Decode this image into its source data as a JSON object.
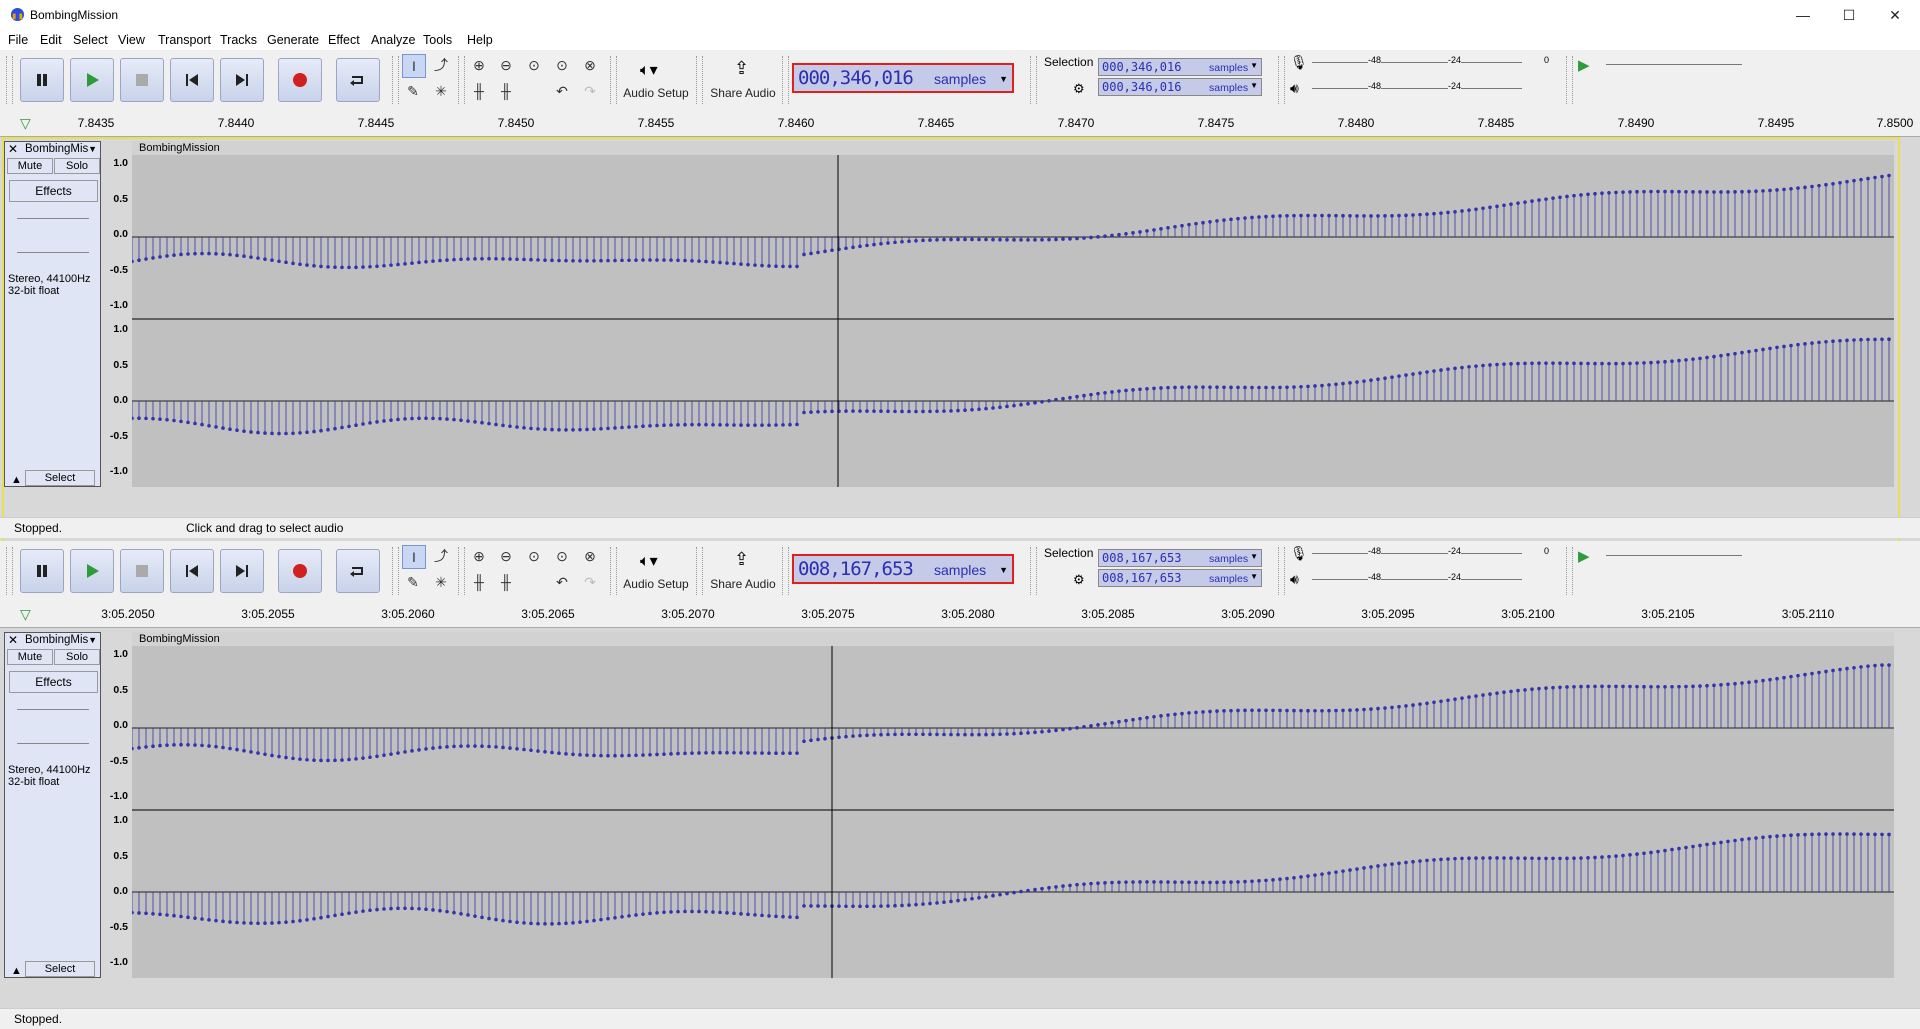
{
  "window": {
    "title": "BombingMission",
    "minimize": "—",
    "maximize": "☐",
    "close": "✕"
  },
  "menu": [
    "File",
    "Edit",
    "Select",
    "View",
    "Transport",
    "Tracks",
    "Generate",
    "Effect",
    "Analyze",
    "Tools",
    "Help"
  ],
  "toolbar": {
    "audio_setup": "Audio Setup",
    "share_audio": "Share Audio",
    "selection_label": "Selection"
  },
  "meters": {
    "rec_m48": "-48",
    "rec_m24": "-24",
    "rec_0": "0",
    "play_m48": "-48",
    "play_m24": "-24"
  },
  "panels": [
    {
      "time_value": "000,346,016",
      "time_unit": "samples",
      "selection_start": "000,346,016",
      "selection_end": "000,346,016",
      "selection_unit": "samples",
      "ruler_ticks": [
        "7.8435",
        "7.8440",
        "7.8445",
        "7.8450",
        "7.8455",
        "7.8460",
        "7.8465",
        "7.8470",
        "7.8475",
        "7.8480",
        "7.8485",
        "7.8490",
        "7.8495",
        "7.8500"
      ],
      "track": {
        "name": "BombingMis",
        "clip_name": "BombingMission",
        "mute": "Mute",
        "solo": "Solo",
        "effects": "Effects",
        "select": "Select",
        "info1": "Stereo, 44100Hz",
        "info2": "32-bit float"
      },
      "status_left": "Stopped.",
      "status_hint": "Click and drag to select audio"
    },
    {
      "time_value": "008,167,653",
      "time_unit": "samples",
      "selection_start": "008,167,653",
      "selection_end": "008,167,653",
      "selection_unit": "samples",
      "ruler_ticks": [
        "3:05.2050",
        "3:05.2055",
        "3:05.2060",
        "3:05.2065",
        "3:05.2070",
        "3:05.2075",
        "3:05.2080",
        "3:05.2085",
        "3:05.2090",
        "3:05.2095",
        "3:05.2100",
        "3:05.2105",
        "3:05.2110"
      ],
      "track": {
        "name": "BombingMis",
        "clip_name": "BombingMission",
        "mute": "Mute",
        "solo": "Solo",
        "effects": "Effects",
        "select": "Select",
        "info1": "Stereo, 44100Hz",
        "info2": "32-bit float"
      },
      "status_left": "Stopped."
    }
  ],
  "vscale": [
    "1.0",
    "0.5",
    "0.0",
    "-0.5",
    "-1.0"
  ],
  "colors": {
    "accent": "#2b2fb0",
    "highlight_border": "#e0201a",
    "selected_track_border": "#e8e050",
    "waveform": "#3333aa"
  }
}
